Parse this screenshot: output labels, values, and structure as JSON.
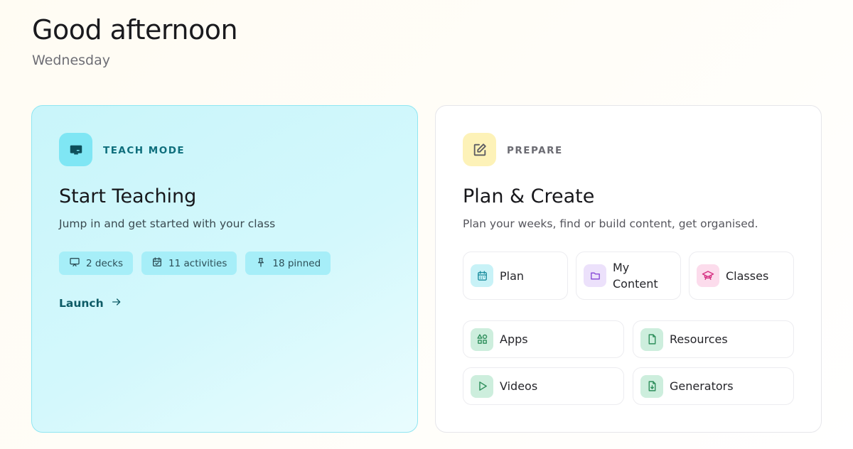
{
  "header": {
    "greeting": "Good afternoon",
    "day": "Wednesday"
  },
  "teach_card": {
    "eyebrow": "TEACH MODE",
    "icon": "presentation-screen-icon",
    "title": "Start Teaching",
    "description": "Jump in and get started with your class",
    "chips": [
      {
        "icon": "slides-icon",
        "label": "2 decks"
      },
      {
        "icon": "calendar-check-icon",
        "label": "11 activities"
      },
      {
        "icon": "pin-icon",
        "label": "18 pinned"
      }
    ],
    "launch_label": "Launch",
    "colors": {
      "accent": "#0e6e7c",
      "background": "#c9f5fa",
      "chip": "#a6eef8"
    }
  },
  "prepare_card": {
    "eyebrow": "PREPARE",
    "icon": "edit-square-icon",
    "title": "Plan & Create",
    "description": "Plan your weeks, find or build content, get organised.",
    "tiles_top": [
      {
        "icon": "calendar-icon",
        "label": "Plan"
      },
      {
        "icon": "folder-icon",
        "label_line1": "My",
        "label_line2": "Content"
      },
      {
        "icon": "graduation-cap-icon",
        "label": "Classes"
      }
    ],
    "tiles_grid": [
      {
        "icon": "apps-shapes-icon",
        "label": "Apps"
      },
      {
        "icon": "document-icon",
        "label": "Resources"
      },
      {
        "icon": "play-icon",
        "label": "Videos"
      },
      {
        "icon": "file-download-icon",
        "label": "Generators"
      }
    ],
    "colors": {
      "icon_bg": "#fdf2b8",
      "purple": "#8a4fd8",
      "pink": "#d63384",
      "green": "#2f8f5c",
      "cyan": "#1f8fa0"
    }
  }
}
